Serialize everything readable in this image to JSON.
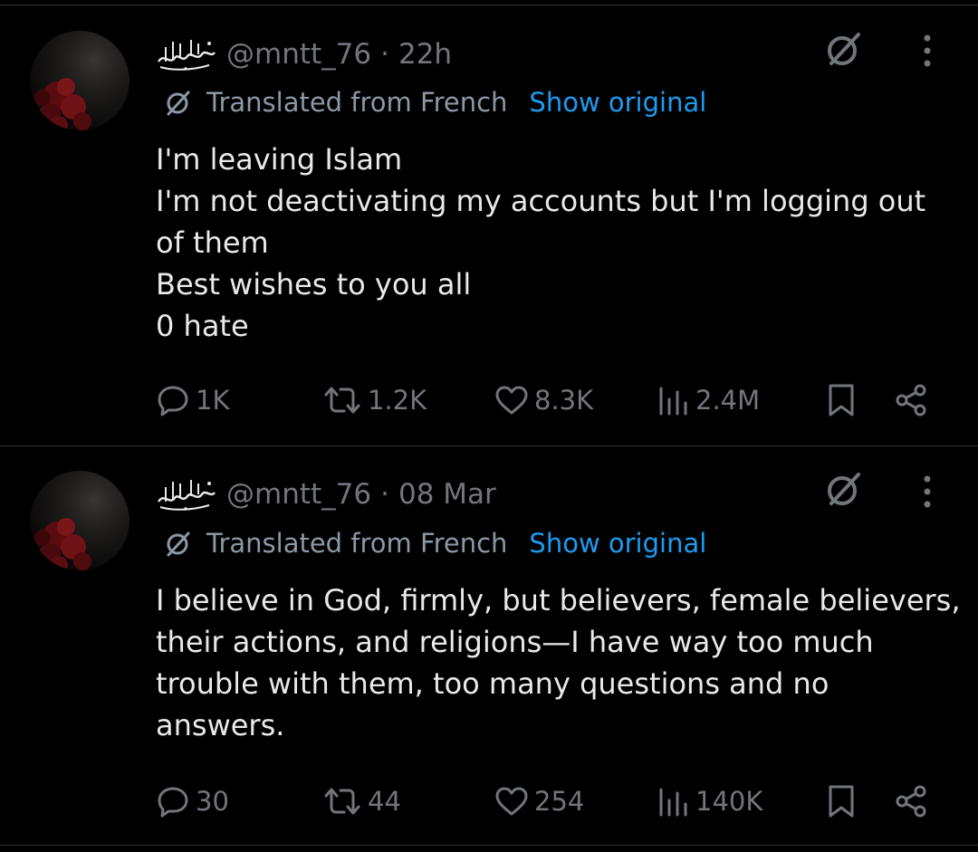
{
  "tweets": [
    {
      "handle": "@mntt_76",
      "time": "22h",
      "translated_label": "Translated from French",
      "show_original": "Show original",
      "lines": [
        "I'm leaving Islam",
        "I'm not deactivating my accounts but I'm logging out",
        "of them",
        "Best wishes to you all",
        "0 hate"
      ],
      "actions": {
        "replies": "1K",
        "reposts": "1.2K",
        "likes": "8.3K",
        "views": "2.4M"
      }
    },
    {
      "handle": "@mntt_76",
      "time": "08 Mar",
      "translated_label": "Translated from French",
      "show_original": "Show original",
      "lines": [
        "I believe in God, firmly, but believers, female believers,",
        "their actions, and religions—I have way too much",
        "trouble with them, too many questions and no",
        "answers."
      ],
      "actions": {
        "replies": "30",
        "reposts": "44",
        "likes": "254",
        "views": "140K"
      }
    }
  ],
  "colors": {
    "background": "#000000",
    "text": "#e7e9ea",
    "muted": "#71767b",
    "link": "#1d9bf0",
    "divider": "#2f3336"
  },
  "icons": [
    "grok-icon",
    "more-icon",
    "translate-slash-icon",
    "reply-icon",
    "repost-icon",
    "like-icon",
    "views-icon",
    "bookmark-icon",
    "share-icon"
  ]
}
